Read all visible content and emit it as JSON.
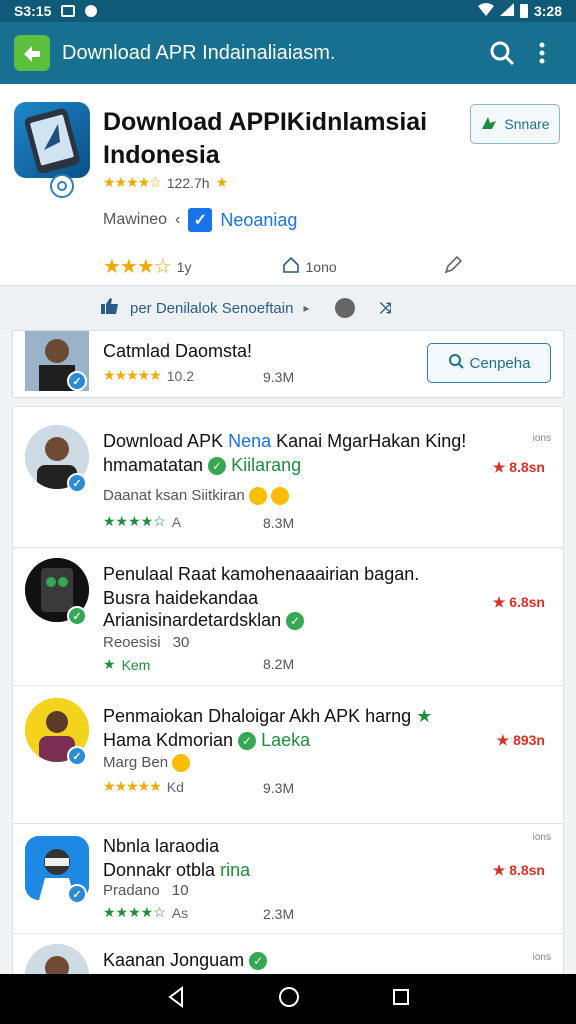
{
  "status": {
    "time_left": "S3:15",
    "time_right": "3:28"
  },
  "app_bar": {
    "title": "Download APR Indainaliaiasm."
  },
  "hero": {
    "title": "Download APPIKidnlamsiai Indonesia",
    "rating_count": "122.7h",
    "share_label": "Snnare",
    "developer": "Mawineo",
    "verified_label": "Neoaniag",
    "meta_rating": "1y",
    "meta_size": "1ono"
  },
  "filter": {
    "label": "per Denilalok Senoeftain"
  },
  "featured": {
    "title": "Catmlad Daomsta!",
    "rating": "10.2",
    "size": "9.3M",
    "compare_label": "Cenpeha"
  },
  "items": [
    {
      "title": "Download APK",
      "title_blue": "Nena",
      "title_rest": "Kanai MgarHakan King!",
      "line2": "hmamatatan",
      "line2_green": "Kiilarang",
      "line3": "Daanat ksan Siitkiran",
      "rating": "A",
      "size": "8.3M",
      "price": "8.8sn",
      "tag": "ions"
    },
    {
      "title": "Penulaal Raat kamohenaaairian bagan.",
      "line2": "Busra haidekandaa",
      "line3": "Arianisinardetardsklan",
      "line4": "Reoesisi",
      "line4_num": "30",
      "rating": "Kem",
      "size": "8.2M",
      "price": "6.8sn",
      "tag": ""
    },
    {
      "title": "Penmaiokan Dhaloigar Akh APK harng",
      "line2": "Hama Kdmorian",
      "line2_green": "Laeka",
      "line3": "Marg Ben",
      "rating": "Kd",
      "size": "9.3M",
      "price": "893n",
      "tag": ""
    },
    {
      "title": "Nbnla laraodia",
      "line2": "Donnakr otbla",
      "line2_green": "rina",
      "line3": "Pradano",
      "line3_num": "10",
      "rating": "As",
      "size": "2.3M",
      "price": "8.8sn",
      "tag": "ions"
    },
    {
      "title": "Kaanan Jonguam",
      "tag": "ions"
    }
  ],
  "colors": {
    "app_bar": "#17708f",
    "status_bar": "#0e5a78",
    "accent_green": "#5cbf3e",
    "price_red": "#d93025"
  }
}
